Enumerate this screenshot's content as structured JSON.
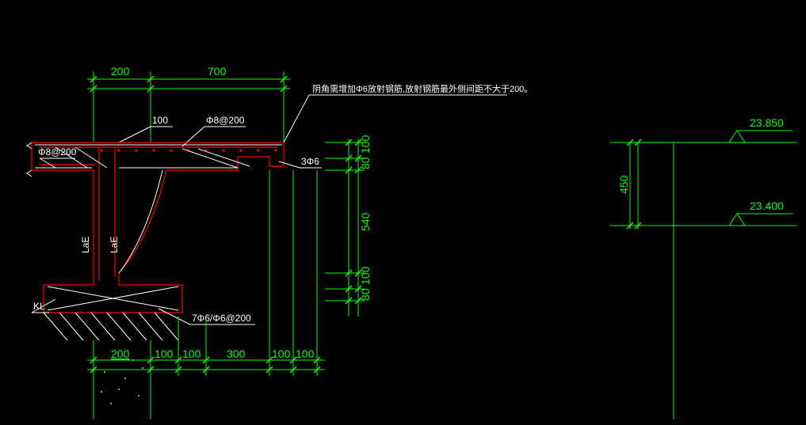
{
  "dims_top": {
    "a": "200",
    "b": "700"
  },
  "dims_bottom": {
    "a": "200",
    "b": "100",
    "c": "100",
    "d": "300",
    "e": "100",
    "f": "100"
  },
  "dims_right": {
    "a": "100",
    "b": "80",
    "c": "540",
    "d": "100",
    "e": "80"
  },
  "callouts": {
    "top_inner": "100",
    "rebar_a": "Φ8@200",
    "rebar_b": "Φ8@200",
    "rebar_c": "3Φ6",
    "rebar_d": "7Φ6/Φ6@200",
    "note": "阴角需增加Φ6放射钢筋,放射钢筋最外侧间距不大于200。",
    "kl": "KL",
    "lae1": "LaE",
    "lae2": "LaE"
  },
  "elevations": {
    "top": "23.850",
    "bottom": "23.400",
    "diff": "450"
  },
  "chart_data": {
    "type": "table",
    "description": "Structural section / detail drawing (CAD). Cantilever slab/corbel detail with dimensions in mm, rebar callouts, and two elevation markers to the right.",
    "units": "mm (elevations in m)",
    "top_dimensions": [
      200,
      700
    ],
    "bottom_dimensions": [
      200,
      100,
      100,
      300,
      100,
      100
    ],
    "right_vertical_dimensions": [
      100,
      80,
      540,
      100,
      80
    ],
    "rebar": [
      "Φ8@200",
      "Φ8@200",
      "3Φ6",
      "7Φ6/Φ6@200"
    ],
    "labels": [
      "KL",
      "LaE",
      "LaE",
      "100"
    ],
    "note": "阴角需增加Φ6放射钢筋,放射钢筋最外侧间距不大于200。",
    "elevations": {
      "upper": 23.85,
      "lower": 23.4,
      "difference_mm": 450
    }
  }
}
